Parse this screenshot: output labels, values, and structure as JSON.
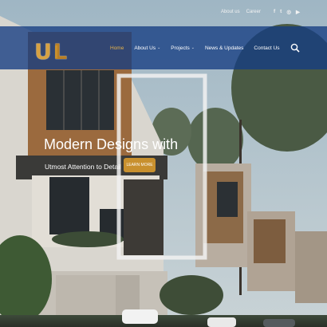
{
  "topbar": {
    "links": [
      "About us",
      "Career"
    ],
    "social": [
      {
        "icon": "facebook-icon",
        "glyph": "f"
      },
      {
        "icon": "twitter-icon",
        "glyph": "t"
      },
      {
        "icon": "instagram-icon",
        "glyph": "◎"
      },
      {
        "icon": "youtube-icon",
        "glyph": "▶"
      }
    ]
  },
  "logo": {
    "letter_u": "U",
    "letter_l": "L"
  },
  "nav": {
    "items": [
      {
        "label": "Home",
        "chevron": ""
      },
      {
        "label": "About Us",
        "chevron": "⌄"
      },
      {
        "label": "Projects",
        "chevron": "⌄"
      },
      {
        "label": "News & Updates",
        "chevron": ""
      },
      {
        "label": "Contact Us",
        "chevron": ""
      }
    ],
    "active_index": 0,
    "search_icon": "search-icon"
  },
  "hero": {
    "heading": "Modern Designs with",
    "subheading": "Utmost Attention to Detail",
    "cta_label": "LEARN MORE"
  },
  "colors": {
    "nav_bg": "#143c82",
    "accent": "#c8902e",
    "text": "#ffffff"
  }
}
